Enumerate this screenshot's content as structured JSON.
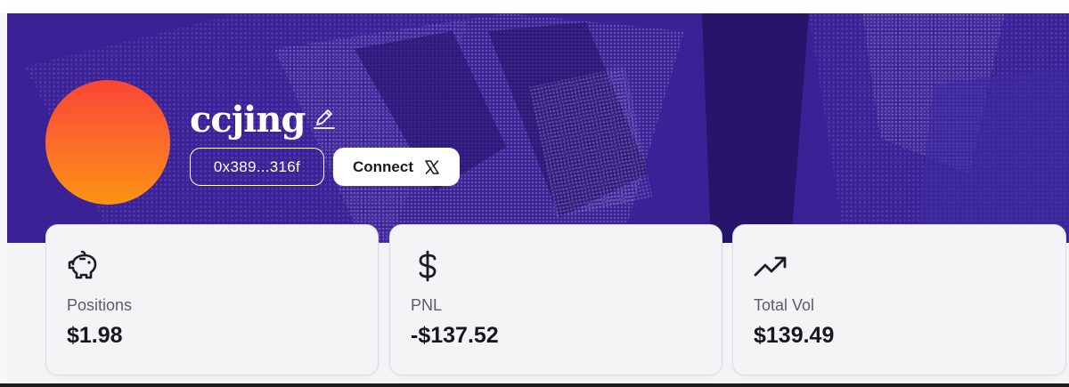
{
  "profile": {
    "username": "ccjing",
    "address": "0x389...316f",
    "connect_label": "Connect"
  },
  "stats": [
    {
      "icon": "piggy-bank-icon",
      "label": "Positions",
      "value": "$1.98"
    },
    {
      "icon": "dollar-icon",
      "label": "PNL",
      "value": "-$137.52"
    },
    {
      "icon": "trending-up-icon",
      "label": "Total Vol",
      "value": "$139.49"
    }
  ],
  "colors": {
    "banner": "#3a2196",
    "avatar_top": "#fb4535",
    "avatar_bottom": "#fd9412",
    "card_bg": "#f4f4f7"
  }
}
